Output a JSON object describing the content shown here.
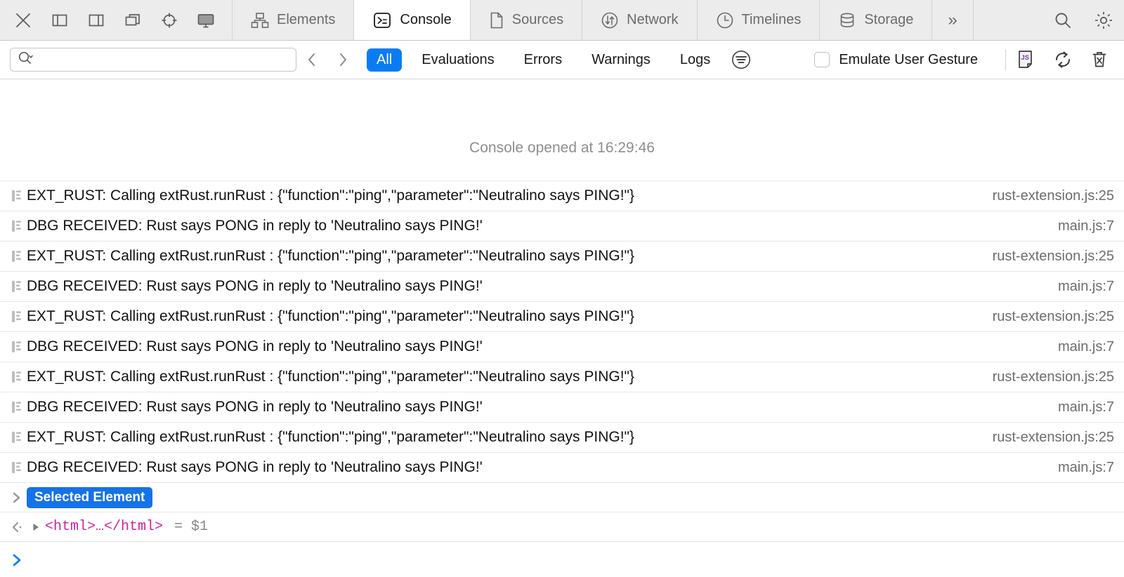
{
  "toolbar": {
    "left_buttons": [
      {
        "name": "close-icon",
        "label": "Close"
      },
      {
        "name": "dock-left-icon",
        "label": "Dock to Left"
      },
      {
        "name": "dock-right-icon",
        "label": "Dock to Right"
      },
      {
        "name": "dock-window-icon",
        "label": "Detach into Separate Window"
      },
      {
        "name": "inspect-element-icon",
        "label": "Select Element"
      },
      {
        "name": "device-icon",
        "label": "Device Settings"
      }
    ],
    "tabs": [
      {
        "label": "Elements",
        "icon": "elements-icon",
        "active": false
      },
      {
        "label": "Console",
        "icon": "console-icon",
        "active": true
      },
      {
        "label": "Sources",
        "icon": "sources-icon",
        "active": false
      },
      {
        "label": "Network",
        "icon": "network-icon",
        "active": false
      },
      {
        "label": "Timelines",
        "icon": "timelines-icon",
        "active": false
      },
      {
        "label": "Storage",
        "icon": "storage-icon",
        "active": false
      }
    ],
    "overflow_label": "»",
    "right_buttons": [
      {
        "name": "search-icon",
        "label": "Search"
      },
      {
        "name": "gear-icon",
        "label": "Settings"
      }
    ]
  },
  "filterbar": {
    "search": {
      "value": "",
      "placeholder": ""
    },
    "nav_prev_label": "‹",
    "nav_next_label": "›",
    "levels": [
      {
        "label": "All",
        "active": true
      },
      {
        "label": "Evaluations",
        "active": false
      },
      {
        "label": "Errors",
        "active": false
      },
      {
        "label": "Warnings",
        "active": false
      },
      {
        "label": "Logs",
        "active": false
      }
    ],
    "emulate_label": "Emulate User Gesture",
    "emulate_checked": false,
    "end_buttons": [
      {
        "name": "js-context-icon",
        "label": "JS",
        "color": "#7b3fb5"
      },
      {
        "name": "preserve-log-icon",
        "label": "Preserve Log"
      },
      {
        "name": "clear-console-icon",
        "label": "Clear Console"
      }
    ]
  },
  "console": {
    "opened_message": "Console opened at 16:29:46",
    "messages": [
      {
        "text": "EXT_RUST: Calling extRust.runRust : {\"function\":\"ping\",\"parameter\":\"Neutralino says PING!\"}",
        "source": "rust-extension.js:25"
      },
      {
        "text": "DBG RECEIVED: Rust says PONG in reply to 'Neutralino says PING!'",
        "source": "main.js:7"
      },
      {
        "text": "EXT_RUST: Calling extRust.runRust : {\"function\":\"ping\",\"parameter\":\"Neutralino says PING!\"}",
        "source": "rust-extension.js:25"
      },
      {
        "text": "DBG RECEIVED: Rust says PONG in reply to 'Neutralino says PING!'",
        "source": "main.js:7"
      },
      {
        "text": "EXT_RUST: Calling extRust.runRust : {\"function\":\"ping\",\"parameter\":\"Neutralino says PING!\"}",
        "source": "rust-extension.js:25"
      },
      {
        "text": "DBG RECEIVED: Rust says PONG in reply to 'Neutralino says PING!'",
        "source": "main.js:7"
      },
      {
        "text": "EXT_RUST: Calling extRust.runRust : {\"function\":\"ping\",\"parameter\":\"Neutralino says PING!\"}",
        "source": "rust-extension.js:25"
      },
      {
        "text": "DBG RECEIVED: Rust says PONG in reply to 'Neutralino says PING!'",
        "source": "main.js:7"
      },
      {
        "text": "EXT_RUST: Calling extRust.runRust : {\"function\":\"ping\",\"parameter\":\"Neutralino says PING!\"}",
        "source": "rust-extension.js:25"
      },
      {
        "text": "DBG RECEIVED: Rust says PONG in reply to 'Neutralino says PING!'",
        "source": "main.js:7"
      }
    ],
    "selected_element_badge": "Selected Element",
    "result": {
      "html_token": "<html>…</html>",
      "equals": "=  $1"
    },
    "prompt": {
      "value": "",
      "placeholder": ""
    }
  },
  "colors": {
    "accent_blue": "#0a7cf3",
    "badge_blue": "#1572e8",
    "html_magenta": "#c5269b",
    "toolbar_bg": "#ececec"
  }
}
